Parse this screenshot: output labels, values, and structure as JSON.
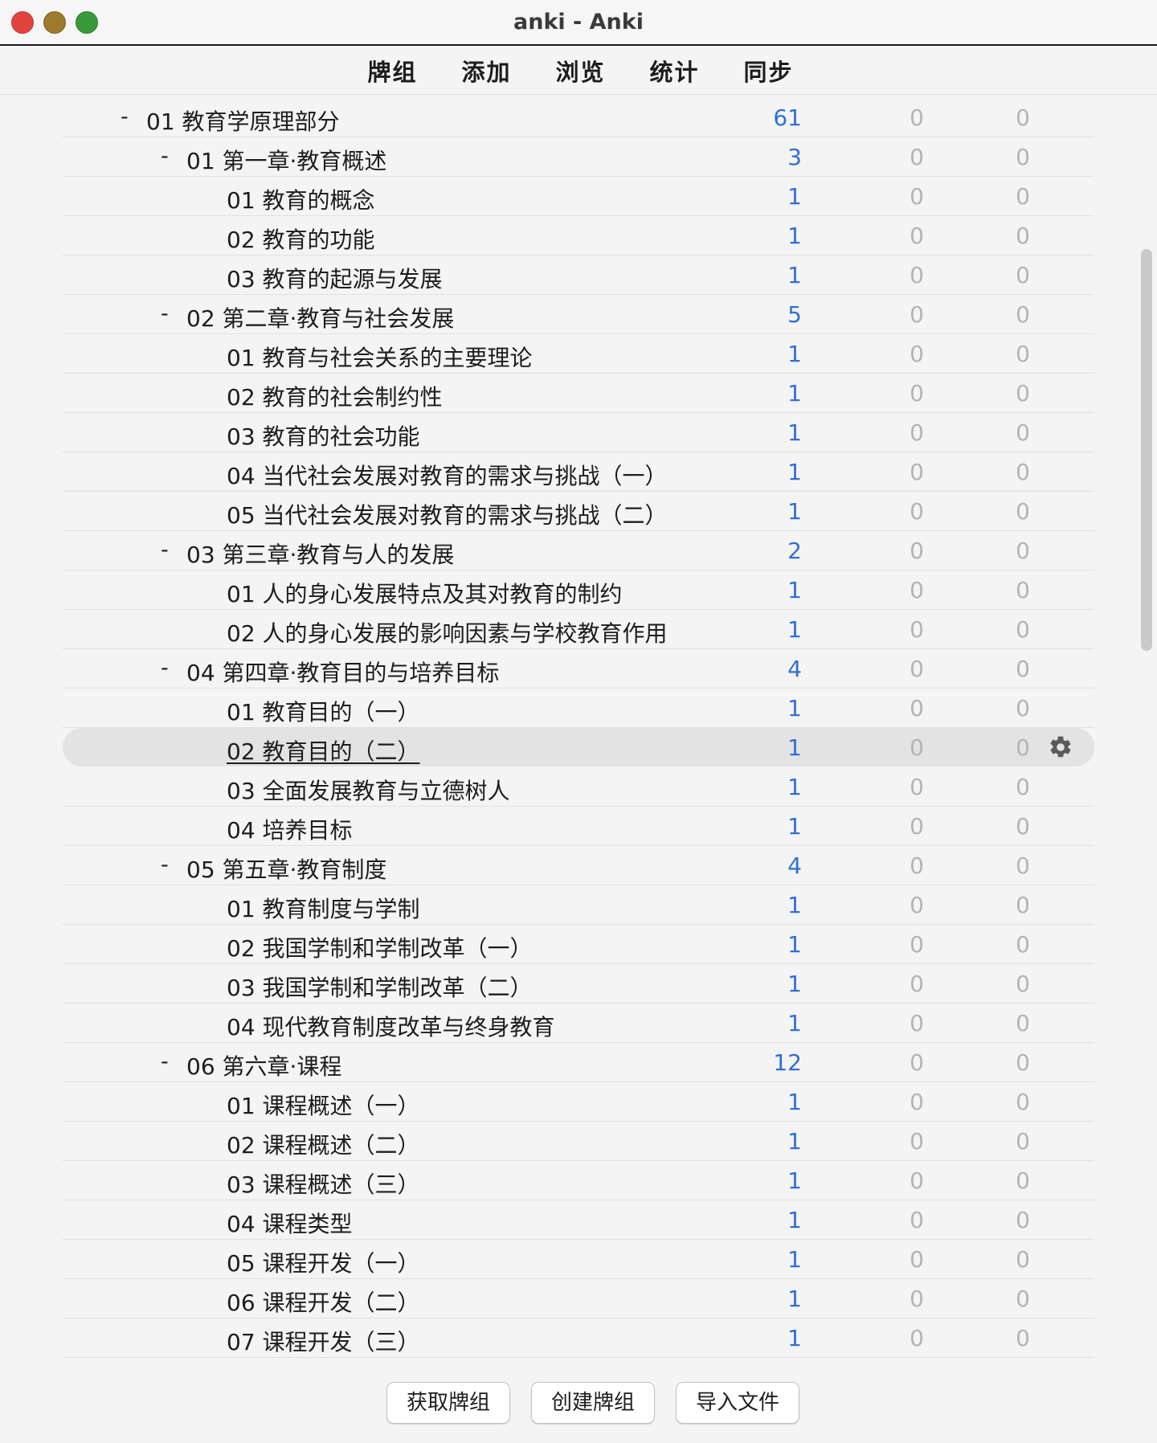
{
  "window": {
    "title": "anki - Anki"
  },
  "toolbar": {
    "decks": "牌组",
    "add": "添加",
    "browse": "浏览",
    "stats": "统计",
    "sync": "同步"
  },
  "rows": [
    {
      "level": 0,
      "collapse": "-",
      "name": "01 教育学原理部分",
      "new": "61",
      "learn": "0",
      "due": "0"
    },
    {
      "level": 1,
      "collapse": "-",
      "name": "01 第一章·教育概述",
      "new": "3",
      "learn": "0",
      "due": "0"
    },
    {
      "level": 2,
      "collapse": "",
      "name": "01 教育的概念",
      "new": "1",
      "learn": "0",
      "due": "0"
    },
    {
      "level": 2,
      "collapse": "",
      "name": "02 教育的功能",
      "new": "1",
      "learn": "0",
      "due": "0"
    },
    {
      "level": 2,
      "collapse": "",
      "name": "03 教育的起源与发展",
      "new": "1",
      "learn": "0",
      "due": "0"
    },
    {
      "level": 1,
      "collapse": "-",
      "name": "02 第二章·教育与社会发展",
      "new": "5",
      "learn": "0",
      "due": "0"
    },
    {
      "level": 2,
      "collapse": "",
      "name": "01 教育与社会关系的主要理论",
      "new": "1",
      "learn": "0",
      "due": "0"
    },
    {
      "level": 2,
      "collapse": "",
      "name": "02 教育的社会制约性",
      "new": "1",
      "learn": "0",
      "due": "0"
    },
    {
      "level": 2,
      "collapse": "",
      "name": "03 教育的社会功能",
      "new": "1",
      "learn": "0",
      "due": "0"
    },
    {
      "level": 2,
      "collapse": "",
      "name": "04 当代社会发展对教育的需求与挑战（一）",
      "new": "1",
      "learn": "0",
      "due": "0"
    },
    {
      "level": 2,
      "collapse": "",
      "name": "05 当代社会发展对教育的需求与挑战（二）",
      "new": "1",
      "learn": "0",
      "due": "0"
    },
    {
      "level": 1,
      "collapse": "-",
      "name": "03 第三章·教育与人的发展",
      "new": "2",
      "learn": "0",
      "due": "0"
    },
    {
      "level": 2,
      "collapse": "",
      "name": "01 人的身心发展特点及其对教育的制约",
      "new": "1",
      "learn": "0",
      "due": "0"
    },
    {
      "level": 2,
      "collapse": "",
      "name": "02 人的身心发展的影响因素与学校教育作用",
      "new": "1",
      "learn": "0",
      "due": "0"
    },
    {
      "level": 1,
      "collapse": "-",
      "name": "04 第四章·教育目的与培养目标",
      "new": "4",
      "learn": "0",
      "due": "0"
    },
    {
      "level": 2,
      "collapse": "",
      "name": "01 教育目的（一）",
      "new": "1",
      "learn": "0",
      "due": "0"
    },
    {
      "level": 2,
      "collapse": "",
      "name": "02 教育目的（二）",
      "new": "1",
      "learn": "0",
      "due": "0",
      "selected": true
    },
    {
      "level": 2,
      "collapse": "",
      "name": "03 全面发展教育与立德树人",
      "new": "1",
      "learn": "0",
      "due": "0"
    },
    {
      "level": 2,
      "collapse": "",
      "name": "04 培养目标",
      "new": "1",
      "learn": "0",
      "due": "0"
    },
    {
      "level": 1,
      "collapse": "-",
      "name": "05 第五章·教育制度",
      "new": "4",
      "learn": "0",
      "due": "0"
    },
    {
      "level": 2,
      "collapse": "",
      "name": "01 教育制度与学制",
      "new": "1",
      "learn": "0",
      "due": "0"
    },
    {
      "level": 2,
      "collapse": "",
      "name": "02 我国学制和学制改革（一）",
      "new": "1",
      "learn": "0",
      "due": "0"
    },
    {
      "level": 2,
      "collapse": "",
      "name": "03 我国学制和学制改革（二）",
      "new": "1",
      "learn": "0",
      "due": "0"
    },
    {
      "level": 2,
      "collapse": "",
      "name": "04 现代教育制度改革与终身教育",
      "new": "1",
      "learn": "0",
      "due": "0"
    },
    {
      "level": 1,
      "collapse": "-",
      "name": "06 第六章·课程",
      "new": "12",
      "learn": "0",
      "due": "0"
    },
    {
      "level": 2,
      "collapse": "",
      "name": "01 课程概述（一）",
      "new": "1",
      "learn": "0",
      "due": "0"
    },
    {
      "level": 2,
      "collapse": "",
      "name": "02 课程概述（二）",
      "new": "1",
      "learn": "0",
      "due": "0"
    },
    {
      "level": 2,
      "collapse": "",
      "name": "03 课程概述（三）",
      "new": "1",
      "learn": "0",
      "due": "0"
    },
    {
      "level": 2,
      "collapse": "",
      "name": "04 课程类型",
      "new": "1",
      "learn": "0",
      "due": "0"
    },
    {
      "level": 2,
      "collapse": "",
      "name": "05 课程开发（一）",
      "new": "1",
      "learn": "0",
      "due": "0"
    },
    {
      "level": 2,
      "collapse": "",
      "name": "06 课程开发（二）",
      "new": "1",
      "learn": "0",
      "due": "0"
    },
    {
      "level": 2,
      "collapse": "",
      "name": "07 课程开发（三）",
      "new": "1",
      "learn": "0",
      "due": "0"
    }
  ],
  "footer": {
    "get_shared": "获取牌组",
    "create_deck": "创建牌组",
    "import_file": "导入文件"
  },
  "colors": {
    "new_count": "#2f6fd6",
    "zero_count": "#b4b4b4",
    "selected_row": "#e3e3e3"
  },
  "icons": {
    "options": "gear-icon"
  }
}
